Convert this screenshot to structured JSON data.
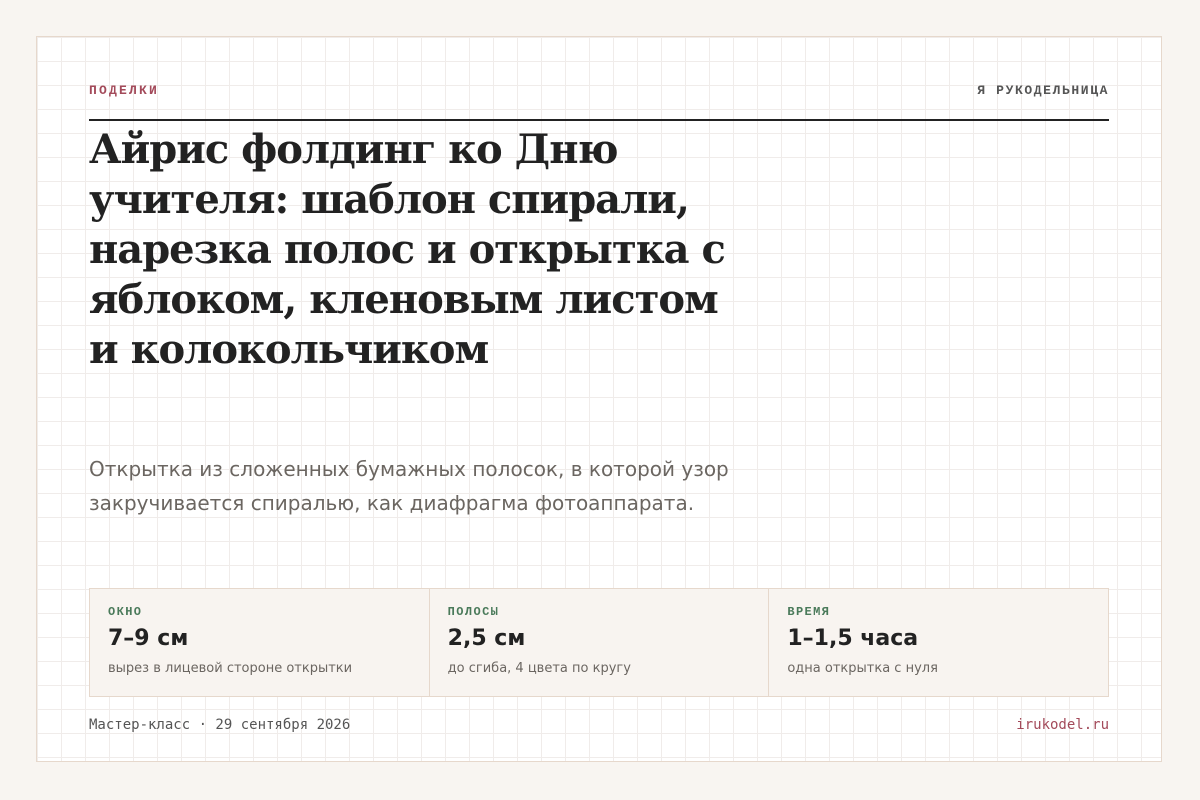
{
  "header": {
    "kicker": "ПОДЕЛКИ",
    "brand": "Я РУКОДЕЛЬНИЦА"
  },
  "title": "Айрис фолдинг ко Дню учителя: шаблон спирали, нарезка полос и открытка с яблоком, кленовым листом и колокольчиком",
  "lede": "Открытка из сложенных бумажных полосок, в которой узор закручивается спиралью, как диафрагма фотоаппарата.",
  "stats": [
    {
      "label": "ОКНО",
      "value": "7–9 см",
      "note": "вырез в лицевой стороне открытки"
    },
    {
      "label": "ПОЛОСЫ",
      "value": "2,5 см",
      "note": "до сгиба, 4 цвета по кругу"
    },
    {
      "label": "ВРЕМЯ",
      "value": "1–1,5 часа",
      "note": "одна открытка с нуля"
    }
  ],
  "footer": {
    "meta": "Мастер-класс · 29 сентября 2026",
    "site": "irukodel.ru"
  },
  "colors": {
    "accent": "#a34a5a",
    "label_green": "#4a7a5a",
    "text": "#222222",
    "muted": "#6b6661",
    "background": "#f8f5f1",
    "border": "#e6d8cc"
  }
}
